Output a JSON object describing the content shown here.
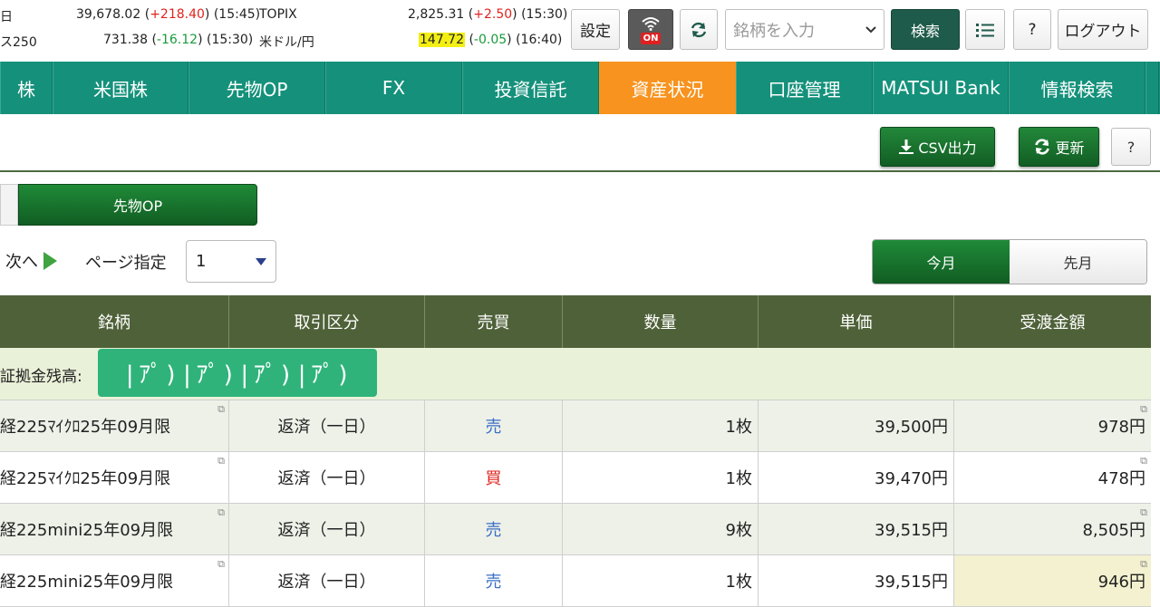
{
  "ticker": {
    "row1_left_label": "日",
    "nikkei_value": "39,678.02",
    "nikkei_change": "+218.40",
    "nikkei_time": "(15:45)",
    "topix_label": "TOPIX",
    "topix_value": "2,825.31",
    "topix_change": "+2.50",
    "topix_time": "(15:30)",
    "row2_left_label": "ス250",
    "growth_value": "731.38",
    "growth_change": "-16.12",
    "growth_time": "(15:30)",
    "usdjpy_label": "米ドル/円",
    "usdjpy_value": "147.72",
    "usdjpy_change": "-0.05",
    "usdjpy_time": "(16:40)"
  },
  "toolbar": {
    "settings_label": "設定",
    "wifi_state": "ON",
    "search_placeholder": "銘柄を入力",
    "search_button": "検索",
    "help_label": "?",
    "logout_label": "ログアウト"
  },
  "nav": {
    "items": [
      {
        "label": "株"
      },
      {
        "label": "米国株"
      },
      {
        "label": "先物OP"
      },
      {
        "label": "FX"
      },
      {
        "label": "投資信託"
      },
      {
        "label": "資産状況",
        "active": true
      },
      {
        "label": "口座管理"
      },
      {
        "label": "MATSUI Bank"
      },
      {
        "label": "情報検索"
      }
    ]
  },
  "actions": {
    "csv_label": "CSV出力",
    "refresh_label": "更新",
    "help_label": "?"
  },
  "tabs": {
    "futures_label": "先物OP"
  },
  "pager": {
    "next_label": "次へ",
    "page_label": "ページ指定",
    "page_value": "1"
  },
  "month_toggle": {
    "this_month": "今月",
    "last_month": "先月"
  },
  "table": {
    "headers": [
      "銘柄",
      "取引区分",
      "売買",
      "数量",
      "単価",
      "受渡金額"
    ],
    "margin_label": "証拠金残高:",
    "margin_masked": "|ｱﾟ)|ｱﾟ)|ｱﾟ)|ｱﾟ)",
    "rows": [
      {
        "name": "経225ﾏｲｸﾛ25年09月限",
        "type": "返済（一日）",
        "side": "売",
        "qty": "1枚",
        "price": "39,500円",
        "amount": "978円"
      },
      {
        "name": "経225ﾏｲｸﾛ25年09月限",
        "type": "返済（一日）",
        "side": "買",
        "qty": "1枚",
        "price": "39,470円",
        "amount": "478円"
      },
      {
        "name": "経225mini25年09月限",
        "type": "返済（一日）",
        "side": "売",
        "qty": "9枚",
        "price": "39,515円",
        "amount": "8,505円"
      },
      {
        "name": "経225mini25年09月限",
        "type": "返済（一日）",
        "side": "売",
        "qty": "1枚",
        "price": "39,515円",
        "amount": "946円"
      }
    ]
  }
}
